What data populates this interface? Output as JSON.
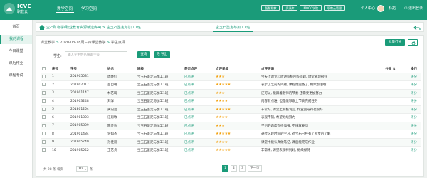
{
  "app": {
    "logo_title": "ICVE",
    "logo_sub": "职教云"
  },
  "nav": [
    {
      "label": "教学空间",
      "active": true
    },
    {
      "label": "学习空间",
      "active": false
    }
  ],
  "top_buttons": [
    "智慧职教",
    "资源库",
    "MOOC学院",
    "职教云管理"
  ],
  "personal_center": "个人中心",
  "username": "朴拓",
  "logout": "退出登录",
  "sidebar": [
    {
      "label": "首页",
      "active": false
    },
    {
      "label": "我的课程",
      "active": true
    },
    {
      "label": "今日课堂",
      "active": false
    },
    {
      "label": "课后作业",
      "active": false
    },
    {
      "label": "课程考试",
      "active": false
    }
  ],
  "breadcrumb": {
    "path": "宝石矿物学(职业教育资源精选库A) > 宝玉石鉴定与加工1班",
    "tab": "宝玉石鉴定与加工1班"
  },
  "subcrumb": {
    "items": [
      "课堂教学",
      "2020-03-18周三四课堂教学",
      "学生点评"
    ]
  },
  "batch_button": "批量打分",
  "search": {
    "label": "学生:",
    "placeholder": "输入学生姓名搜索学号"
  },
  "query_button": "查询",
  "export_button": "导出",
  "table": {
    "headers": [
      "序号",
      "学号",
      "姓名",
      "班级",
      "是否点评",
      "点评星级",
      "点评评语",
      "分数",
      "操作"
    ],
    "rows": [
      {
        "no": "1",
        "id": "201905031",
        "name": "周晓红",
        "class": "宝玉石鉴定与加工1班",
        "status": "已点评",
        "stars": 3,
        "comment": "今天上课专心听讲积极回答问题, 课堂表现很好",
        "score": "",
        "action": "评分"
      },
      {
        "no": "2",
        "id": "201902017",
        "name": "吕自朝",
        "class": "宝玉石鉴定与加工1班",
        "status": "已点评",
        "stars": 5,
        "comment": "表示了之前的问题, 课程更完备了, 继续加油哦",
        "score": "",
        "action": "评分"
      },
      {
        "no": "3",
        "id": "201901147",
        "name": "林艺琦",
        "class": "宝玉石鉴定与加工1班",
        "status": "已点评",
        "stars": 3,
        "comment": "还可以, 能跟着老师的节奏 还需要更加努力",
        "score": "",
        "action": "评分"
      },
      {
        "no": "4",
        "id": "201903248",
        "name": "刘洋",
        "class": "宝玉石鉴定与加工1班",
        "status": "已点评",
        "stars": 4,
        "comment": "内容有点难, 但是能够跟上节奏完成任务",
        "score": "",
        "action": "评分"
      },
      {
        "no": "5",
        "id": "201801254",
        "name": "黄向远",
        "class": "宝玉石鉴定与加工1班",
        "status": "已点评",
        "stars": 5,
        "comment": "非常好, 课堂上积极发言, 作业完成得也很好",
        "score": "",
        "action": "评分"
      },
      {
        "no": "6",
        "id": "201901303",
        "name": "汪思敏",
        "class": "宝玉石鉴定与加工1班",
        "status": "已点评",
        "stars": 4,
        "comment": "表现不错, 希望继续努力",
        "score": "",
        "action": "评分"
      },
      {
        "no": "7",
        "id": "201905809",
        "name": "陈佳怡",
        "class": "宝玉石鉴定与加工1班",
        "status": "已点评",
        "stars": 3,
        "comment": "学习的态度有待加强, 不懂就要问",
        "score": "",
        "action": "评分"
      },
      {
        "no": "8",
        "id": "201901484",
        "name": "许如杰",
        "class": "宝玉石鉴定与加工1班",
        "status": "已点评",
        "stars": 5,
        "comment": "通过这段时间的学习, 对宝石已经有了初步的了解",
        "score": "",
        "action": "评分"
      },
      {
        "no": "9",
        "id": "201905749",
        "name": "孙佳丽",
        "class": "宝玉石鉴定与加工1班",
        "status": "已点评",
        "stars": 4,
        "comment": "课堂中能认真做笔记, 课后能完成作业",
        "score": "",
        "action": "评分"
      },
      {
        "no": "10",
        "id": "201905252",
        "name": "王艺贞",
        "class": "宝玉石鉴定与加工1班",
        "status": "已点评",
        "stars": 5,
        "comment": "非常棒, 课堂表现特别好, 继续保持",
        "score": "",
        "action": "评分"
      }
    ]
  },
  "footer": {
    "count_text": "共 28 条 每页",
    "page_size": "10",
    "unit": "条"
  },
  "pagination": {
    "pages": [
      "1",
      "2",
      "3"
    ],
    "current": "1",
    "next": "下一页"
  },
  "colors": {
    "brand": "#1a9b79",
    "star": "#f3a20f"
  }
}
